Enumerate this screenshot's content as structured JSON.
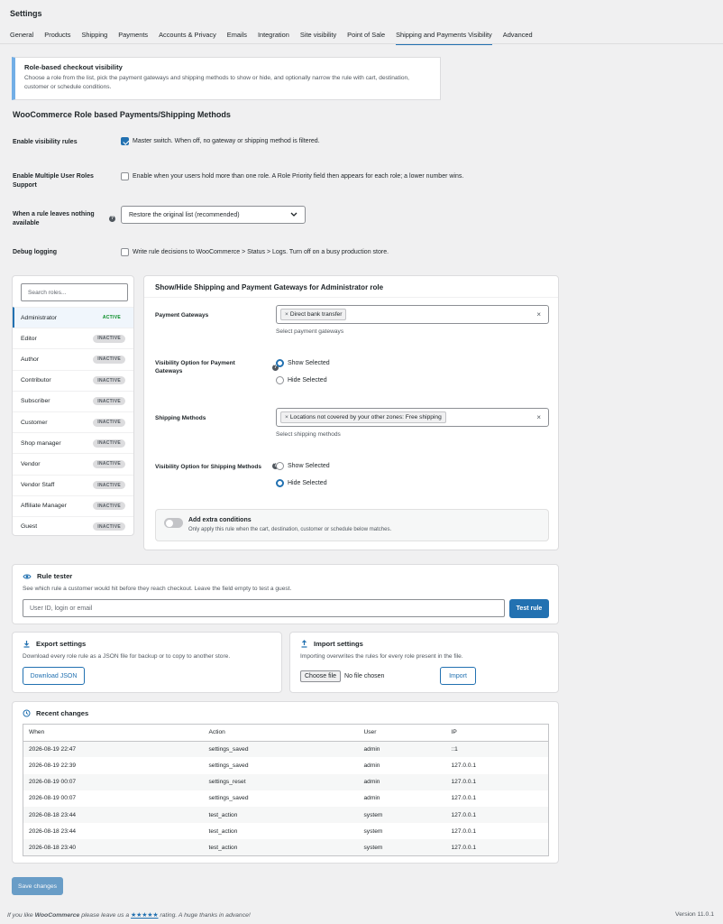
{
  "page_title": "Settings",
  "tabs": [
    "General",
    "Products",
    "Shipping",
    "Payments",
    "Accounts & Privacy",
    "Emails",
    "Integration",
    "Site visibility",
    "Point of Sale",
    "Shipping and Payments Visibility",
    "Advanced"
  ],
  "active_tab": "Shipping and Payments Visibility",
  "notice": {
    "title": "Role-based checkout visibility",
    "description": "Choose a role from the list, pick the payment gateways and shipping methods to show or hide, and optionally narrow the rule with cart, destination, customer or schedule conditions."
  },
  "section_title": "WooCommerce Role based Payments/Shipping Methods",
  "settings": {
    "enable_visibility": {
      "label": "Enable visibility rules",
      "text": "Master switch. When off, no gateway or shipping method is filtered.",
      "checked": true
    },
    "multiple_roles": {
      "label": "Enable Multiple User Roles Support",
      "text": "Enable when your users hold more than one role. A Role Priority field then appears for each role; a lower number wins.",
      "checked": false
    },
    "fallback": {
      "label": "When a rule leaves nothing available",
      "value": "Restore the original list (recommended)"
    },
    "debug": {
      "label": "Debug logging",
      "text": "Write rule decisions to WooCommerce > Status > Logs. Turn off on a busy production store.",
      "checked": false
    }
  },
  "roles": {
    "search_placeholder": "Search roles...",
    "items": [
      {
        "name": "Administrator",
        "status": "ACTIVE"
      },
      {
        "name": "Editor",
        "status": "INACTIVE"
      },
      {
        "name": "Author",
        "status": "INACTIVE"
      },
      {
        "name": "Contributor",
        "status": "INACTIVE"
      },
      {
        "name": "Subscriber",
        "status": "INACTIVE"
      },
      {
        "name": "Customer",
        "status": "INACTIVE"
      },
      {
        "name": "Shop manager",
        "status": "INACTIVE"
      },
      {
        "name": "Vendor",
        "status": "INACTIVE"
      },
      {
        "name": "Vendor Staff",
        "status": "INACTIVE"
      },
      {
        "name": "Affiliate Manager",
        "status": "INACTIVE"
      },
      {
        "name": "Guest",
        "status": "INACTIVE"
      }
    ]
  },
  "panel": {
    "title": "Show/Hide Shipping and Payment Gateways for Administrator role",
    "payment_gateways_label": "Payment Gateways",
    "payment_gateways_tag": "Direct bank transfer",
    "payment_gateways_hint": "Select payment gateways",
    "payment_visibility_label": "Visibility Option for Payment Gateways",
    "shipping_methods_label": "Shipping Methods",
    "shipping_methods_tag": "Locations not covered by your other zones: Free shipping",
    "shipping_methods_hint": "Select shipping methods",
    "shipping_visibility_label": "Visibility Option for Shipping Methods",
    "show_selected": "Show Selected",
    "hide_selected": "Hide Selected",
    "payment_visibility": "show",
    "shipping_visibility": "hide",
    "extra_title": "Add extra conditions",
    "extra_desc": "Only apply this rule when the cart, destination, customer or schedule below matches.",
    "extra_enabled": false
  },
  "rule_tester": {
    "title": "Rule tester",
    "description": "See which rule a customer would hit before they reach checkout. Leave the field empty to test a guest.",
    "placeholder": "User ID, login or email",
    "button": "Test rule"
  },
  "export": {
    "title": "Export settings",
    "description": "Download every role rule as a JSON file for backup or to copy to another store.",
    "button": "Download JSON"
  },
  "import": {
    "title": "Import settings",
    "description": "Importing overwrites the rules for every role present in the file.",
    "choose_file": "Choose file",
    "no_file": "No file chosen",
    "button": "Import"
  },
  "recent_changes": {
    "title": "Recent changes",
    "columns": [
      "When",
      "Action",
      "User",
      "IP"
    ],
    "rows": [
      [
        "2026-08-19 22:47",
        "settings_saved",
        "admin",
        "::1"
      ],
      [
        "2026-08-19 22:39",
        "settings_saved",
        "admin",
        "127.0.0.1"
      ],
      [
        "2026-08-19 00:07",
        "settings_reset",
        "admin",
        "127.0.0.1"
      ],
      [
        "2026-08-19 00:07",
        "settings_saved",
        "admin",
        "127.0.0.1"
      ],
      [
        "2026-08-18 23:44",
        "test_action",
        "system",
        "127.0.0.1"
      ],
      [
        "2026-08-18 23:44",
        "test_action",
        "system",
        "127.0.0.1"
      ],
      [
        "2026-08-18 23:40",
        "test_action",
        "system",
        "127.0.0.1"
      ]
    ]
  },
  "save_button": "Save changes",
  "footer": {
    "prefix": "If you like ",
    "brand": "WooCommerce",
    "middle": " please leave us a ",
    "stars": "★★★★★",
    "suffix": " rating. A huge thanks in advance!"
  },
  "version": "Version 11.0.1",
  "colors": {
    "accent": "#2271b1",
    "active": "#008a20",
    "notice_border": "#72aee6"
  }
}
